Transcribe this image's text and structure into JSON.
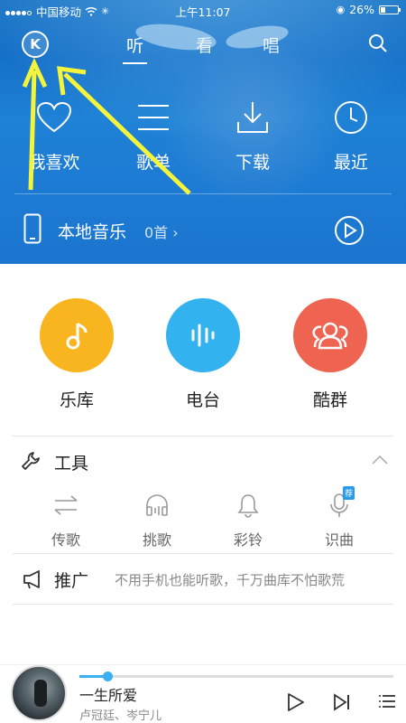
{
  "status": {
    "carrier": "中国移动",
    "time": "上午11:07",
    "battery": "26%",
    "battery_level": 0.26
  },
  "nav": {
    "avatar_letter": "K",
    "tabs": [
      {
        "label": "听",
        "active": true
      },
      {
        "label": "看",
        "active": false
      },
      {
        "label": "唱",
        "active": false
      }
    ]
  },
  "quick_actions": [
    {
      "label": "我喜欢",
      "icon": "heart-icon"
    },
    {
      "label": "歌单",
      "icon": "list-icon"
    },
    {
      "label": "下载",
      "icon": "download-icon"
    },
    {
      "label": "最近",
      "icon": "clock-icon"
    }
  ],
  "local_music": {
    "label": "本地音乐",
    "count": "0首"
  },
  "categories": [
    {
      "label": "乐库",
      "icon": "music-note-icon",
      "color": "#f9b51f"
    },
    {
      "label": "电台",
      "icon": "radio-wave-icon",
      "color": "#32b2ef"
    },
    {
      "label": "酷群",
      "icon": "group-icon",
      "color": "#ef6450"
    }
  ],
  "tools": {
    "title": "工具",
    "items": [
      {
        "label": "传歌",
        "icon": "transfer-icon"
      },
      {
        "label": "挑歌",
        "icon": "headphones-icon"
      },
      {
        "label": "彩铃",
        "icon": "bell-icon"
      },
      {
        "label": "识曲",
        "icon": "mic-icon",
        "badge": "荐"
      }
    ]
  },
  "promo": {
    "title": "推广",
    "text": "不用手机也能听歌，千万曲库不怕歌荒"
  },
  "player": {
    "song": "一生所爱",
    "artist": "卢冠廷、岑宁儿",
    "progress": 0.09
  },
  "colors": {
    "header_blue": "#1c78cf",
    "accent": "#3ab0f0",
    "annotation_arrow": "#f4f43a"
  }
}
